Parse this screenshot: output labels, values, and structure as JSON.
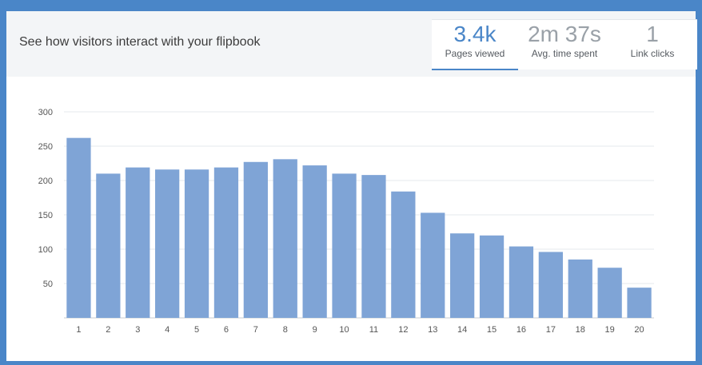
{
  "header": {
    "title": "See how visitors interact with your flipbook"
  },
  "stats": [
    {
      "value": "3.4k",
      "label": "Pages viewed"
    },
    {
      "value": "2m 37s",
      "label": "Avg. time spent"
    },
    {
      "value": "1",
      "label": "Link clicks"
    }
  ],
  "colors": {
    "accent": "#4a86c8",
    "bar": "#7fa4d6"
  },
  "chart_data": {
    "type": "bar",
    "categories": [
      "1",
      "2",
      "3",
      "4",
      "5",
      "6",
      "7",
      "8",
      "9",
      "10",
      "11",
      "12",
      "13",
      "14",
      "15",
      "16",
      "17",
      "18",
      "19",
      "20"
    ],
    "values": [
      262,
      210,
      219,
      216,
      216,
      219,
      227,
      231,
      222,
      210,
      208,
      184,
      153,
      123,
      120,
      104,
      96,
      85,
      73,
      44
    ],
    "ylim": [
      0,
      300
    ],
    "yticks": [
      "50",
      "100",
      "150",
      "200",
      "250",
      "300"
    ],
    "grid": true,
    "xlabel": "",
    "ylabel": ""
  }
}
